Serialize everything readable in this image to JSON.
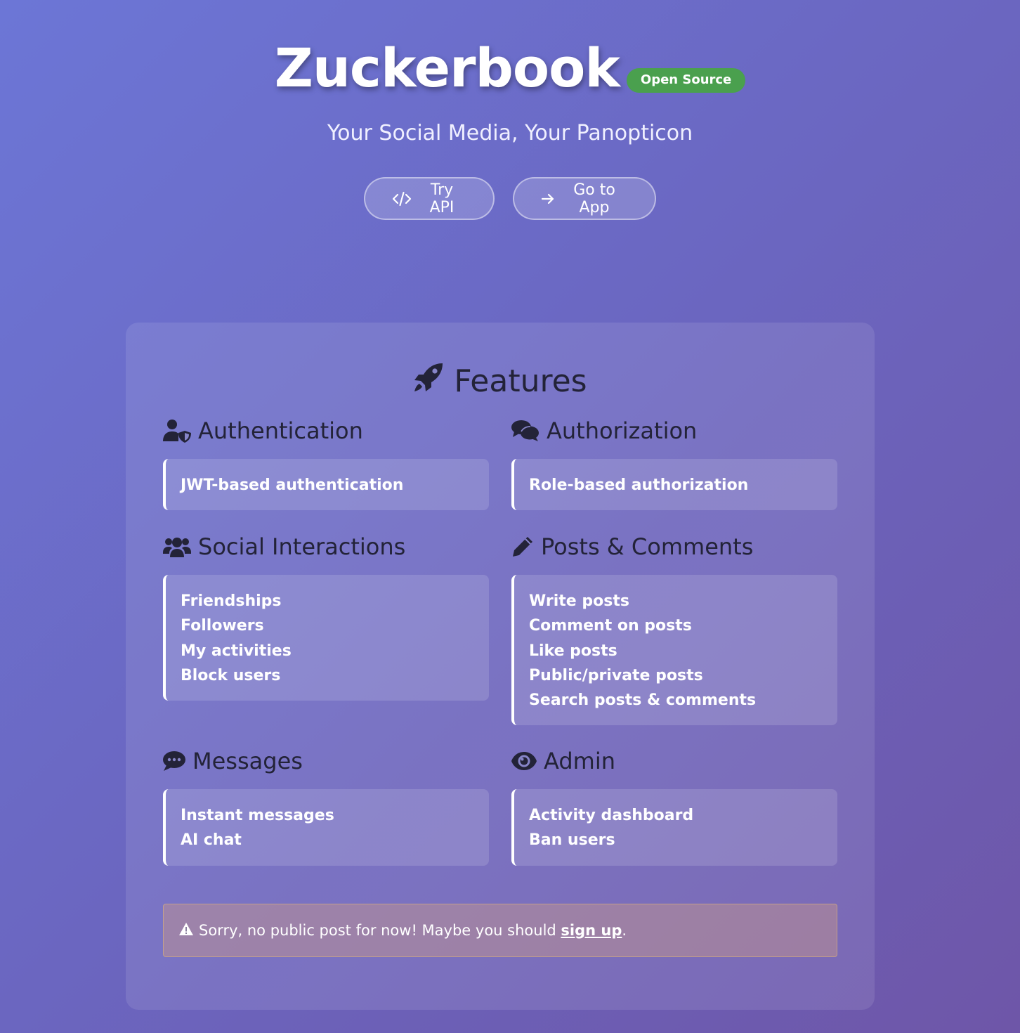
{
  "hero": {
    "title": "Zuckerbook",
    "badge": "Open Source",
    "subtitle": "Your Social Media, Your Panopticon",
    "buttons": {
      "try_api": "Try API",
      "go_to_app": "Go to App"
    }
  },
  "features": {
    "heading": "Features",
    "sections": [
      {
        "title": "Authentication",
        "icon": "user-shield-icon",
        "items": [
          "JWT-based authentication"
        ]
      },
      {
        "title": "Authorization",
        "icon": "comments-icon",
        "items": [
          "Role-based authorization"
        ]
      },
      {
        "title": "Social Interactions",
        "icon": "users-icon",
        "items": [
          "Friendships",
          "Followers",
          "My activities",
          "Block users"
        ]
      },
      {
        "title": "Posts & Comments",
        "icon": "pencil-icon",
        "items": [
          "Write posts",
          "Comment on posts",
          "Like posts",
          "Public/private posts",
          "Search posts & comments"
        ]
      },
      {
        "title": "Messages",
        "icon": "comment-dots-icon",
        "items": [
          "Instant messages",
          "AI chat"
        ]
      },
      {
        "title": "Admin",
        "icon": "eye-icon",
        "items": [
          "Activity dashboard",
          "Ban users"
        ]
      }
    ]
  },
  "alert": {
    "text_before": "Sorry, no public post for now! Maybe you should ",
    "link": "sign up",
    "text_after": "."
  },
  "colors": {
    "badge_green": "#4aa04e",
    "heading_dark": "#232338"
  }
}
